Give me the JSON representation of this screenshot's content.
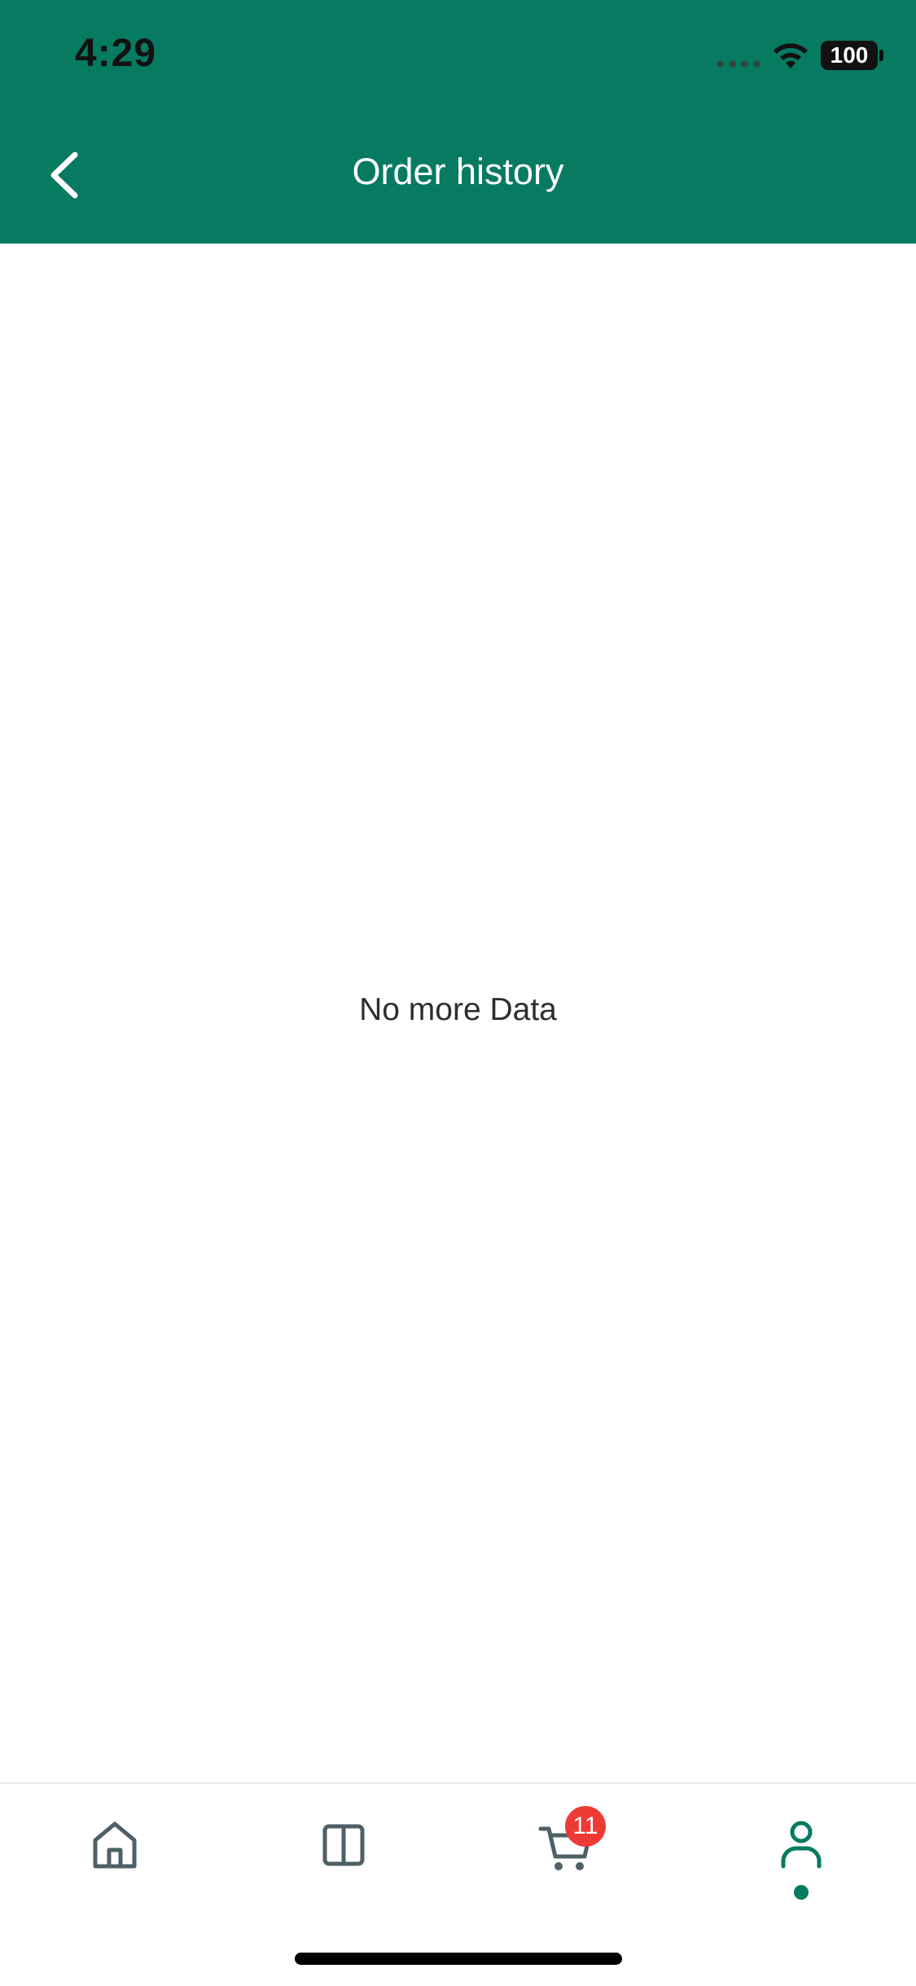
{
  "status_bar": {
    "time": "4:29",
    "battery": "100"
  },
  "header": {
    "title": "Order history",
    "background_color": "#077a62"
  },
  "content": {
    "empty_message": "No more Data"
  },
  "tab_bar": {
    "active_color": "#077a62",
    "inactive_color": "#4e5f68",
    "items": [
      {
        "name": "home",
        "icon": "home-icon",
        "active": false
      },
      {
        "name": "catalog",
        "icon": "split-view-icon",
        "active": false
      },
      {
        "name": "cart",
        "icon": "cart-icon",
        "active": false,
        "badge": "11"
      },
      {
        "name": "profile",
        "icon": "person-icon",
        "active": true
      }
    ],
    "badge_color": "#ee3a35"
  }
}
